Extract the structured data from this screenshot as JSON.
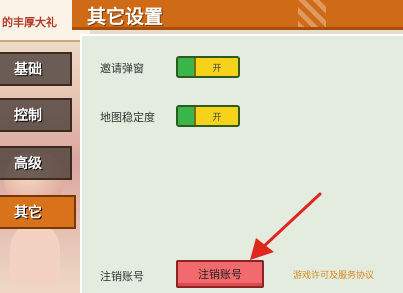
{
  "window": {
    "title": "其它设置"
  },
  "background": {
    "banner_text": "的丰厚大礼"
  },
  "sidebar": {
    "items": [
      {
        "label": "基础"
      },
      {
        "label": "控制"
      },
      {
        "label": "高级"
      },
      {
        "label": "其它",
        "active": true
      }
    ]
  },
  "settings": {
    "invite_popup": {
      "label": "邀请弹窗",
      "toggle_text": "开"
    },
    "map_stability": {
      "label": "地图稳定度",
      "toggle_text": "开"
    },
    "logout": {
      "label": "注销账号",
      "button": "注销账号"
    },
    "agreement_link": "游戏许可及服务协议"
  },
  "colors": {
    "header": "#cf6a17",
    "active_tab": "#d9731b",
    "toggle_on": "#39b54a",
    "toggle_knob": "#f7d21a",
    "logout_button": "#f26a6e",
    "annotation_arrow": "#e0261f"
  }
}
